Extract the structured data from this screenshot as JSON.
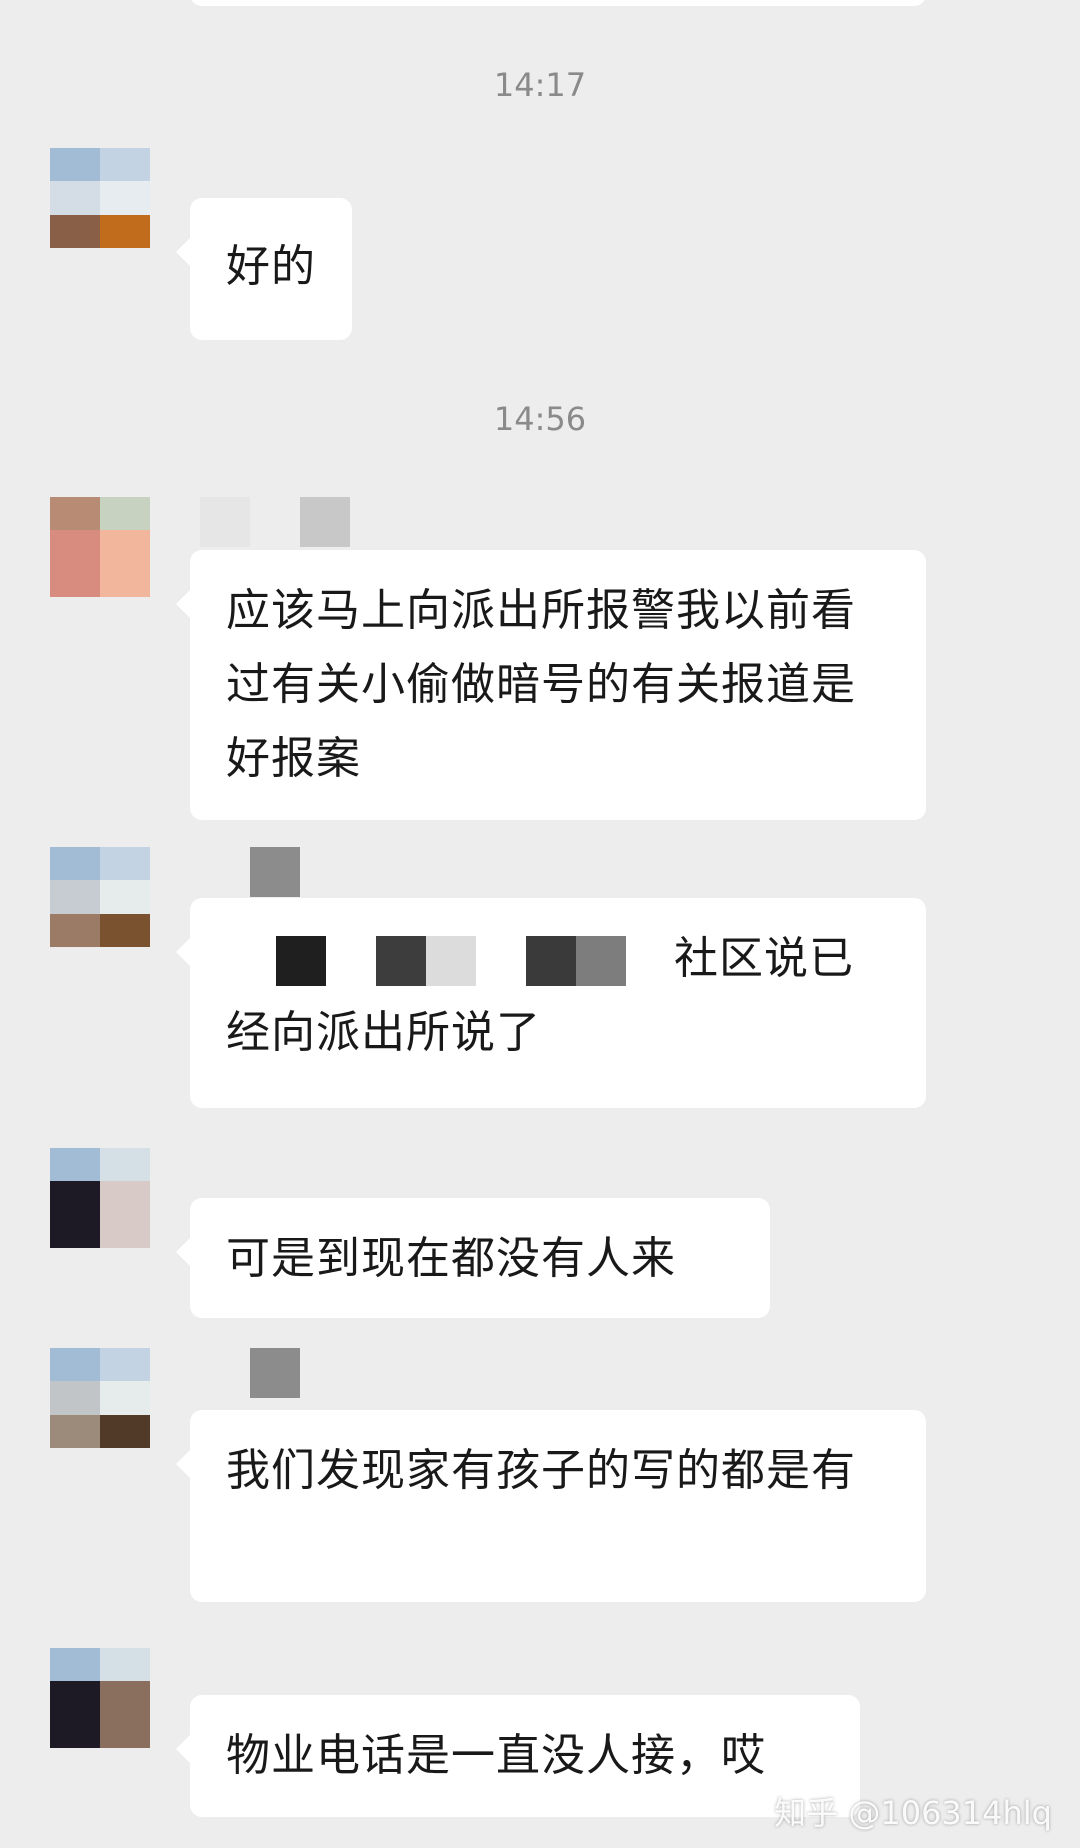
{
  "times": [
    "14:17",
    "14:56"
  ],
  "messages": [
    {
      "text": "好的"
    },
    {
      "text": "应该马上向派出所报警我以前看过有关小偷做暗号的有关报道是好报案"
    },
    {
      "text_after_redaction": "社区说已经向派出所说了"
    },
    {
      "text": "可是到现在都没有人来"
    },
    {
      "text": "我们发现家有孩子的写的都是有"
    },
    {
      "text": "物业电话是一直没人接，哎"
    }
  ],
  "watermark": "知乎 @106314hlq",
  "colors": {
    "background": "#ededed",
    "bubble": "#ffffff",
    "text": "#191919",
    "time": "#8a8a8a"
  }
}
